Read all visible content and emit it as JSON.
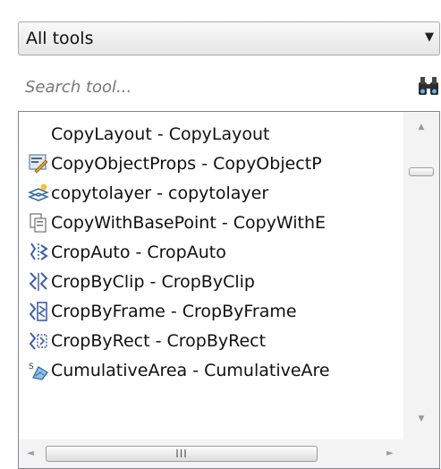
{
  "dropdown": {
    "value": "All tools",
    "arrow": "▼"
  },
  "search": {
    "placeholder": "Search tool...",
    "icon": "binoculars-icon"
  },
  "list": {
    "items": [
      {
        "label": "CopyLayout - CopyLayout",
        "icon": "none"
      },
      {
        "label": "CopyObjectProps - CopyObjectP",
        "icon": "copy-object-props-icon"
      },
      {
        "label": "copytolayer - copytolayer",
        "icon": "copy-to-layer-icon"
      },
      {
        "label": "CopyWithBasePoint - CopyWithE",
        "icon": "copy-with-basepoint-icon"
      },
      {
        "label": "CropAuto - CropAuto",
        "icon": "crop-auto-icon"
      },
      {
        "label": "CropByClip - CropByClip",
        "icon": "crop-by-clip-icon"
      },
      {
        "label": "CropByFrame - CropByFrame",
        "icon": "crop-by-frame-icon"
      },
      {
        "label": "CropByRect - CropByRect",
        "icon": "crop-by-rect-icon"
      },
      {
        "label": "CumulativeArea - CumulativeAre",
        "icon": "cumulative-area-icon"
      }
    ]
  },
  "scrollbar": {
    "up": "▲",
    "down": "▼",
    "left": "◄",
    "right": "►",
    "h_thumb_grip": "III"
  }
}
